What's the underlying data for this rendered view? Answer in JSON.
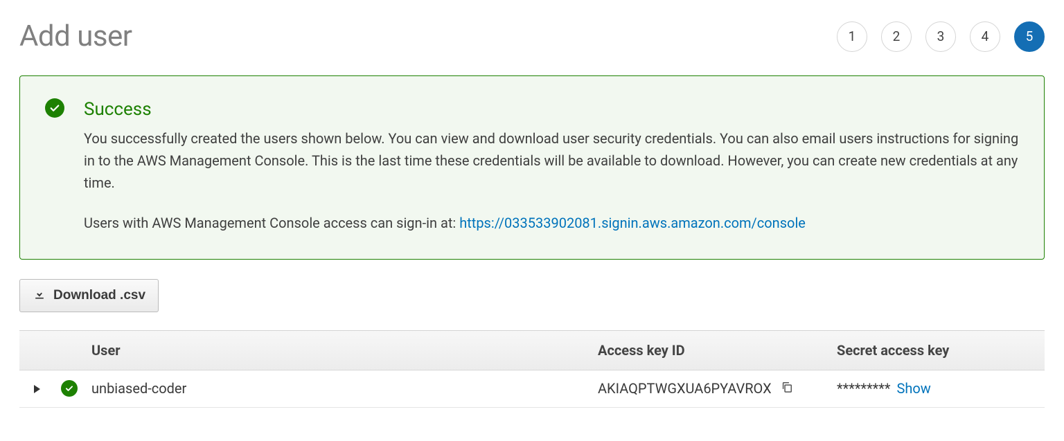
{
  "page": {
    "title": "Add user"
  },
  "wizard": {
    "steps": [
      "1",
      "2",
      "3",
      "4",
      "5"
    ],
    "current_index": 4
  },
  "alert": {
    "title": "Success",
    "body1": "You successfully created the users shown below. You can view and download user security credentials. You can also email users instructions for signing in to the AWS Management Console. This is the last time these credentials will be available to download. However, you can create new credentials at any time.",
    "body2_prefix": "Users with AWS Management Console access can sign-in at: ",
    "signin_url": "https://033533902081.signin.aws.amazon.com/console"
  },
  "actions": {
    "download_csv_label": "Download .csv"
  },
  "table": {
    "headers": {
      "user": "User",
      "access_key_id": "Access key ID",
      "secret": "Secret access key"
    },
    "rows": [
      {
        "user": "unbiased-coder",
        "access_key_id": "AKIAQPTWGXUA6PYAVROX",
        "secret_masked": "*********",
        "show_label": "Show"
      }
    ]
  }
}
